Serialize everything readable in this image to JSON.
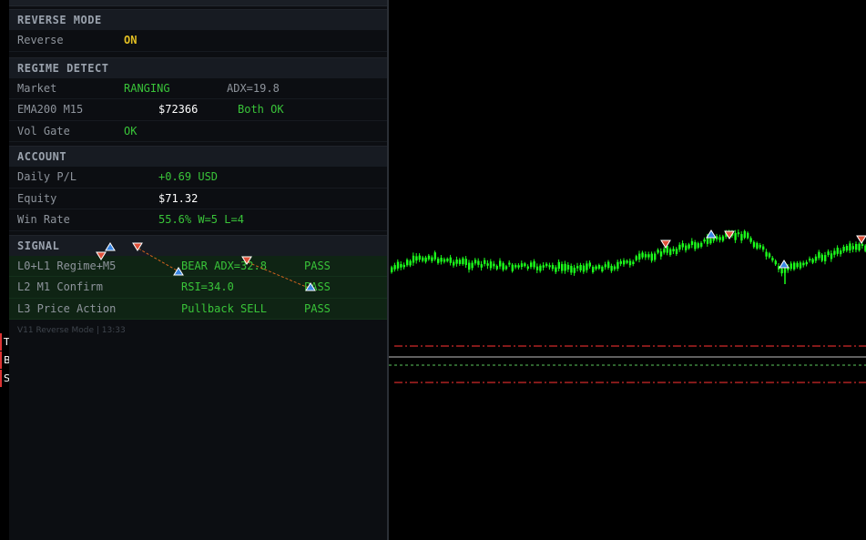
{
  "colors": {
    "green": "#39c439",
    "yellow": "#e2bf23",
    "white": "#ffffff",
    "label": "#8e949c",
    "candle": "#1bff1b",
    "sell_arrow": "#e0513a",
    "buy_arrow": "#3b87e4",
    "level_red": "#d12a2a",
    "level_green": "#5cc75c"
  },
  "reverse_mode": {
    "header": "REVERSE MODE",
    "label": "Reverse",
    "value": "ON"
  },
  "regime": {
    "header": "REGIME DETECT",
    "market": {
      "label": "Market",
      "value": "RANGING",
      "extra": "ADX=19.8"
    },
    "ema": {
      "label": "EMA200 M15",
      "value": "$72366",
      "extra": "Both OK"
    },
    "vol": {
      "label": "Vol Gate",
      "value": "OK"
    }
  },
  "account": {
    "header": "ACCOUNT",
    "daily": {
      "label": "Daily P/L",
      "value": "+0.69 USD"
    },
    "equity": {
      "label": "Equity",
      "value": "$71.32"
    },
    "winrate": {
      "label": "Win Rate",
      "value": "55.6% W=5 L=4"
    }
  },
  "signal": {
    "header": "SIGNAL",
    "rows": [
      {
        "label": "L0+L1 Regime+M5",
        "value": "BEAR ADX=32.8",
        "status": "PASS"
      },
      {
        "label": "L2 M1 Confirm",
        "value": "RSI=34.0",
        "status": "PASS"
      },
      {
        "label": "L3 Price Action",
        "value": "Pullback SELL",
        "status": "PASS"
      }
    ]
  },
  "footer": "V11 Reverse Mode | 13:33",
  "left_strip": [
    "T",
    "B",
    "S"
  ]
}
